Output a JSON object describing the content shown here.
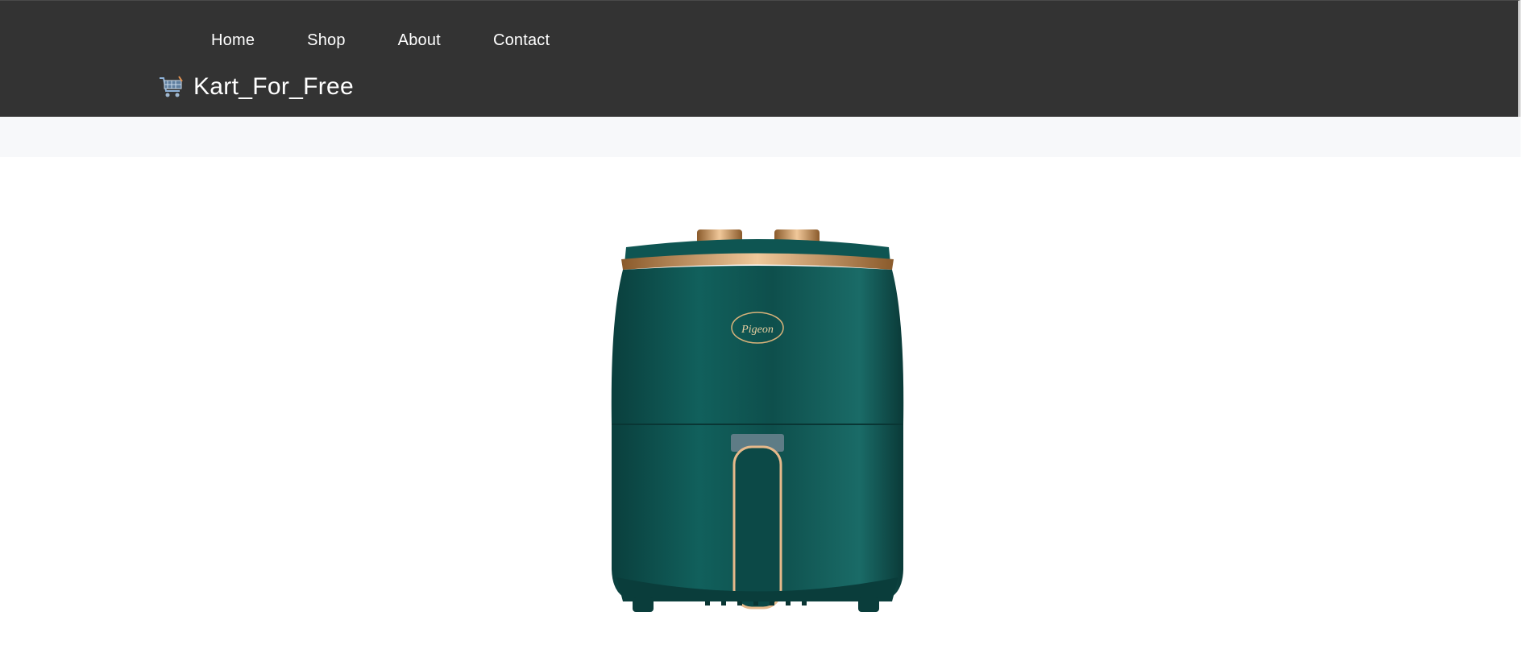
{
  "nav": {
    "items": [
      {
        "label": "Home"
      },
      {
        "label": "Shop"
      },
      {
        "label": "About"
      },
      {
        "label": "Contact"
      }
    ]
  },
  "brand": {
    "name": "Kart_For_Free",
    "icon": "shopping-cart-icon"
  },
  "product": {
    "image_alt": "green air fryer",
    "logo_text": "Pigeon",
    "colors": {
      "body": "#0e4f4c",
      "accent": "#c9935a"
    }
  }
}
